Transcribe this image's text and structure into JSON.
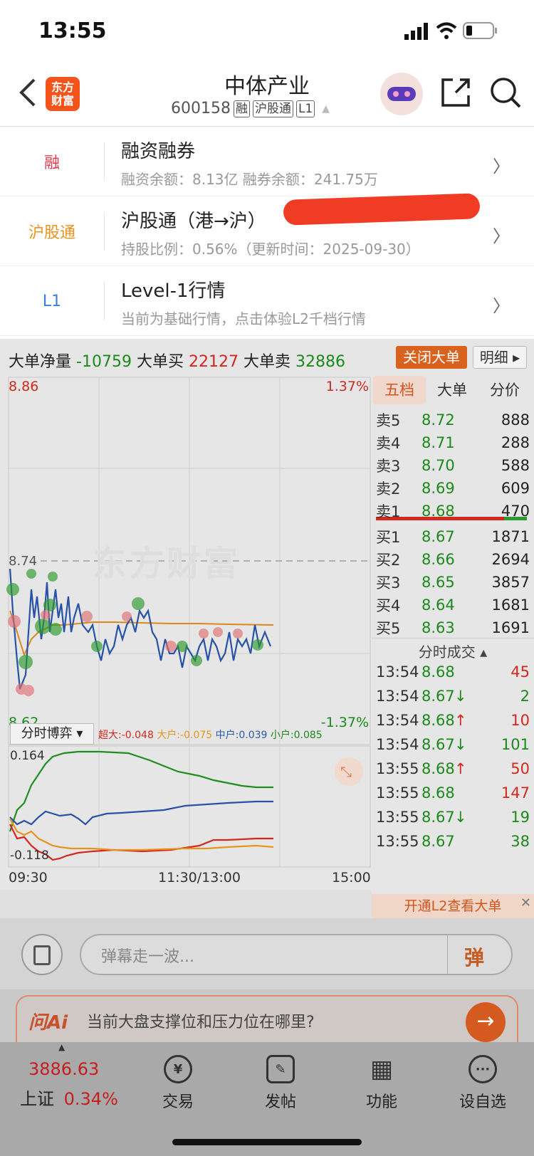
{
  "status": {
    "time": "13:55"
  },
  "header": {
    "logo_line1": "东方",
    "logo_line2": "财富",
    "stock_name": "中体产业",
    "stock_code": "600158",
    "tags": [
      "融",
      "沪股通",
      "L1"
    ]
  },
  "info_rows": [
    {
      "label": "融",
      "label_color": "#e03a4a",
      "title": "融资融券",
      "sub": "融资余额：8.13亿   融券余额：241.75万"
    },
    {
      "label": "沪股通",
      "label_color": "#e8931b",
      "title": "沪股通（港→沪）",
      "sub": "持股比例：0.56%（更新时间：2025-09-30）"
    },
    {
      "label": "L1",
      "label_color": "#3b7fd8",
      "title": "Level-1行情",
      "sub": "当前为基础行情，点击体验L2千档行情"
    }
  ],
  "ticker": {
    "net_label": "大单净量",
    "net_value": "-10759",
    "buy_label": "大单买",
    "buy_value": "22127",
    "sell_label": "大单卖",
    "sell_value": "32886",
    "close_btn": "关闭大单",
    "detail_btn": "明细"
  },
  "chart": {
    "price_high": "8.86",
    "price_mid": "8.74",
    "price_low": "8.62",
    "pct_high": "1.37%",
    "pct_low": "-1.37%",
    "watermark": "东方财富",
    "selector": "分时博弈 ▾",
    "legend": [
      {
        "label": "超大:-0.048",
        "color": "#d4281f"
      },
      {
        "label": "大户:-0.075",
        "color": "#e8931b"
      },
      {
        "label": "中户:0.039",
        "color": "#2a5aa8"
      },
      {
        "label": "小户:0.085",
        "color": "#1a8a1a"
      }
    ],
    "sub_top": "0.164",
    "sub_bottom": "-0.118",
    "x_labels": [
      "09:30",
      "11:30/13:00",
      "15:00"
    ]
  },
  "orderbook": {
    "tabs": [
      "五档",
      "大单",
      "分价"
    ],
    "asks": [
      {
        "label": "卖5",
        "price": "8.72",
        "vol": "888"
      },
      {
        "label": "卖4",
        "price": "8.71",
        "vol": "288"
      },
      {
        "label": "卖3",
        "price": "8.70",
        "vol": "588"
      },
      {
        "label": "卖2",
        "price": "8.69",
        "vol": "609"
      },
      {
        "label": "卖1",
        "price": "8.68",
        "vol": "470"
      }
    ],
    "bids": [
      {
        "label": "买1",
        "price": "8.67",
        "vol": "1871"
      },
      {
        "label": "买2",
        "price": "8.66",
        "vol": "2694"
      },
      {
        "label": "买3",
        "price": "8.65",
        "vol": "3857"
      },
      {
        "label": "买4",
        "price": "8.64",
        "vol": "1681"
      },
      {
        "label": "买5",
        "price": "8.63",
        "vol": "1691"
      }
    ],
    "trades_title": "分时成交 ▴",
    "trades": [
      {
        "time": "13:54",
        "price": "8.68",
        "arrow": "",
        "vol": "45",
        "vol_color": "red"
      },
      {
        "time": "13:54",
        "price": "8.67",
        "arrow": "↓",
        "vol": "2",
        "vol_color": "green"
      },
      {
        "time": "13:54",
        "price": "8.68",
        "arrow": "↑",
        "vol": "10",
        "vol_color": "red"
      },
      {
        "time": "13:54",
        "price": "8.67",
        "arrow": "↓",
        "vol": "101",
        "vol_color": "green"
      },
      {
        "time": "13:55",
        "price": "8.68",
        "arrow": "↑",
        "vol": "50",
        "vol_color": "red"
      },
      {
        "time": "13:55",
        "price": "8.68",
        "arrow": "",
        "vol": "147",
        "vol_color": "red"
      },
      {
        "time": "13:55",
        "price": "8.67",
        "arrow": "↓",
        "vol": "19",
        "vol_color": "green"
      },
      {
        "time": "13:55",
        "price": "8.67",
        "arrow": "",
        "vol": "38",
        "vol_color": "green"
      }
    ],
    "l2_banner": "开通L2查看大单"
  },
  "comment": {
    "placeholder": "弹幕走一波...",
    "danmu_icon": "弹"
  },
  "ai": {
    "logo": "问Ai",
    "question": "当前大盘支撑位和压力位在哪里?"
  },
  "bottom": {
    "index_value": "3886.63",
    "index_name": "上证",
    "index_pct": "0.34%",
    "tabs": [
      {
        "label": "交易",
        "icon": "¥"
      },
      {
        "label": "发帖",
        "icon": "✎"
      },
      {
        "label": "功能",
        "icon": "▦"
      },
      {
        "label": "设自选",
        "icon": "···"
      }
    ]
  }
}
